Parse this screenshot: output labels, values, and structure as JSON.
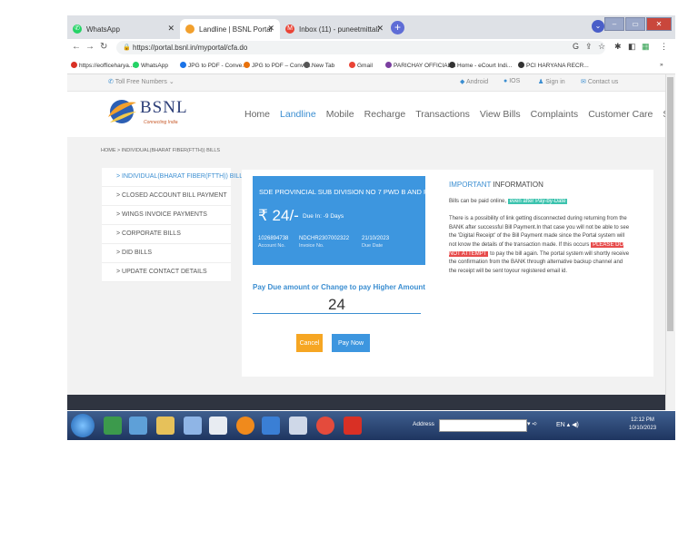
{
  "browser": {
    "tabs": [
      {
        "label": "WhatsApp",
        "icon": "whatsapp-icon",
        "active": false
      },
      {
        "label": "Landline | BSNL Portal",
        "icon": "bsnl-icon",
        "active": true
      },
      {
        "label": "Inbox (11) - puneetmittal2848@g",
        "icon": "gmail-icon",
        "active": false
      }
    ],
    "new_tab": "+",
    "url": "https://portal.bsnl.in/myportal/cfa.do",
    "bookmarks": [
      {
        "label": "https://eofficeharya...",
        "color": "#d93025"
      },
      {
        "label": "WhatsApp",
        "color": "#25d366"
      },
      {
        "label": "JPG to PDF - Conve...",
        "color": "#1a73e8"
      },
      {
        "label": "JPG to PDF – Conve...",
        "color": "#e8710a"
      },
      {
        "label": "New Tab",
        "color": "#555555"
      },
      {
        "label": "Gmail",
        "color": "#ea4335"
      },
      {
        "label": "PARICHAY OFFICIAL...",
        "color": "#7b3fa0"
      },
      {
        "label": "Home - eCourt Indi...",
        "color": "#333333"
      },
      {
        "label": "PCI HARYANA RECR...",
        "color": "#333333"
      }
    ],
    "more_bookmarks": "»"
  },
  "site": {
    "topstrip": {
      "tollfree": "Toll Free Numbers ⌄",
      "android": "Android",
      "ios": "IOS",
      "signin": "Sign in",
      "contact": "Contact us"
    },
    "logo": {
      "text": "BSNL",
      "tagline": "Connecting India"
    },
    "nav": [
      "Home",
      "Landline",
      "Mobile",
      "Recharge",
      "Transactions",
      "View Bills",
      "Complaints",
      "Customer Care",
      "Sign In"
    ],
    "nav_active": "Landline",
    "breadcrumb": "HOME > INDIVIDUAL(BHARAT FIBER(FTTH)) BILLS",
    "side_menu": [
      "> INDIVIDUAL(BHARAT FIBER(FTTH)) BILLS",
      "> CLOSED ACCOUNT BILL PAYMENT",
      "> WINGS INVOICE PAYMENTS",
      "> CORPORATE BILLS",
      "> DID BILLS",
      "> UPDATE CONTACT DETAILS"
    ],
    "bill": {
      "title": "SDE PROVINCIAL SUB DIVISION NO 7 PWD B AND R AMBAL...",
      "amount": "₹ 24/-",
      "due_in": "Due In: -9 Days",
      "account_no": "1026894738",
      "account_label": "Account No.",
      "invoice_no": "NDCHR2307002322",
      "invoice_label": "Invoice No.",
      "due_date": "21/10/2023",
      "due_label": "Due Date"
    },
    "pay": {
      "label": "Pay Due amount or Change to pay Higher Amount",
      "value": "24",
      "cancel": "Cancel",
      "pay_now": "Pay Now"
    },
    "info": {
      "title_a": "IMPORTANT",
      "title_b": "INFORMATION",
      "line1": "Bills can be paid online,",
      "line1_hl": "even after Pay-by-Date",
      "para_a": "There is a possibility of link getting disconnected during returning from the BANK after successful Bill Payment.In that case you will not be able to see the 'Digital Receipt' of the Bill Payment made since the Portal system will not know the details of the transaction made. If this occurs",
      "para_hl": "PLEASE DO NOT ATTEMPT",
      "para_b": "to pay the bill again. The portal system will shortly receive the confirmation from the BANK through alternative backup channel and the receipt will be sent toyour registered email id."
    }
  },
  "taskbar": {
    "address_label": "Address",
    "tray": "EN ▴ ◀)",
    "time": "12:12 PM",
    "date": "10/10/2023"
  }
}
